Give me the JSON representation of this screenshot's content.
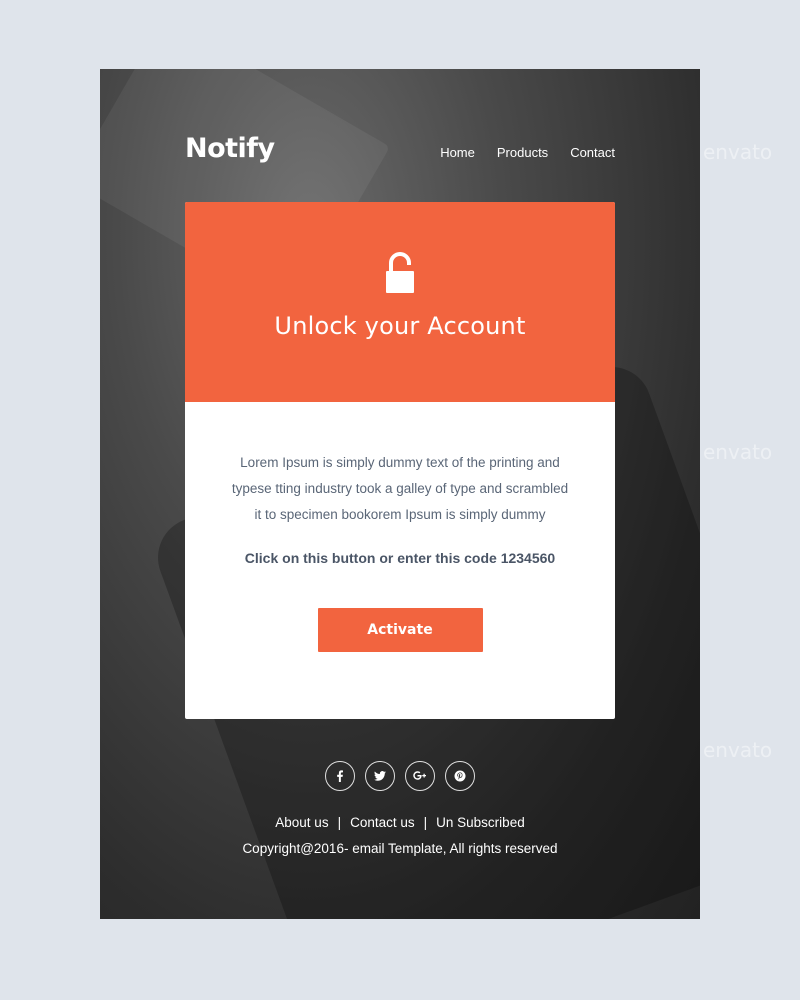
{
  "brand": {
    "name": "Notify"
  },
  "nav": {
    "items": [
      {
        "label": "Home"
      },
      {
        "label": "Products"
      },
      {
        "label": "Contact"
      }
    ]
  },
  "card": {
    "title": "Unlock your Account",
    "paragraph": "Lorem Ipsum is simply dummy text of the printing and typese tting industry took a galley of type and scrambled it to specimen bookorem Ipsum is simply dummy",
    "code_line": "Click on this button or enter this code 1234560",
    "button_label": "Activate",
    "accent_color": "#f2643f"
  },
  "social": [
    {
      "icon": "facebook-icon",
      "glyph": "f"
    },
    {
      "icon": "twitter-icon",
      "glyph": "🐦"
    },
    {
      "icon": "google-plus-icon",
      "glyph": "g+"
    },
    {
      "icon": "pinterest-icon",
      "glyph": "P"
    }
  ],
  "footer": {
    "links": [
      {
        "label": "About us"
      },
      {
        "label": "Contact us"
      },
      {
        "label": "Un Subscribed"
      }
    ],
    "separator": "|",
    "copyright": "Copyright@2016- email Template,  All rights reserved"
  },
  "watermarks": {
    "text": "envato"
  }
}
